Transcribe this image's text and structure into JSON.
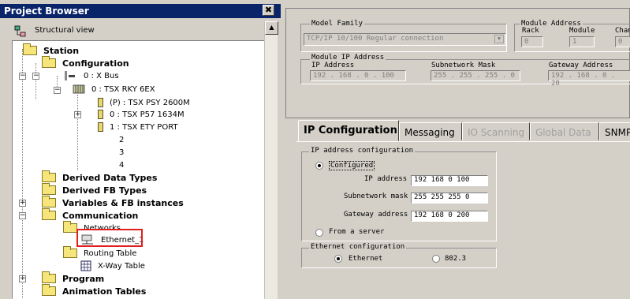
{
  "project_browser": {
    "title": "Project Browser",
    "close": "✖",
    "structural_view": "Structural view",
    "tree": {
      "station": "Station",
      "configuration": "Configuration",
      "bus": "0 : X Bus",
      "rack": "0 : TSX RKY 6EX",
      "slot_p": "(P) : TSX PSY 2600M",
      "slot_0": "0 : TSX P57 1634M",
      "slot_1": "1 : TSX ETY PORT",
      "slot_2": "2",
      "slot_3": "3",
      "slot_4": "4",
      "derived_data": "Derived Data Types",
      "derived_fb": "Derived FB Types",
      "variables": "Variables & FB instances",
      "communication": "Communication",
      "networks": "Networks",
      "ethernet": "Ethernet_1",
      "routing": "Routing Table",
      "xway": "X-Way Table",
      "program": "Program",
      "animation": "Animation Tables"
    }
  },
  "module": {
    "model_family_label": "Model Family",
    "model_family_value": "TCP/IP 10/100 Regular connection",
    "module_address_label": "Module Address",
    "rack_label": "Rack",
    "rack_value": "0",
    "module_label": "Module",
    "module_value": "1",
    "channel_label": "Chan",
    "channel_value": "0",
    "ip_group_label": "Module IP Address",
    "ip_label": "IP Address",
    "ip_value": "192 . 168 .  0  . 100",
    "subnet_label": "Subnetwork Mask",
    "subnet_value": "255 . 255 . 255 .  0",
    "gateway_label": "Gateway Address",
    "gateway_value": "192 . 168 .  0  . 20"
  },
  "tabs": [
    {
      "label": "IP Configuration"
    },
    {
      "label": "Messaging"
    },
    {
      "label": "IO Scanning"
    },
    {
      "label": "Global Data"
    },
    {
      "label": "SNMP"
    }
  ],
  "ip_config": {
    "group_label": "IP address configuration",
    "configured_label": "Configured",
    "ip_label": "IP address",
    "ip_value": "192  168   0  100",
    "subnet_label": "Subnetwork mask",
    "subnet_value": "255  255  255   0",
    "gateway_label": "Gateway address",
    "gateway_value": "192  168   0  200",
    "from_server_label": "From a server",
    "eth_group_label": "Ethernet configuration",
    "ethernet_label": "Ethernet",
    "ieee_label": "802.3"
  }
}
